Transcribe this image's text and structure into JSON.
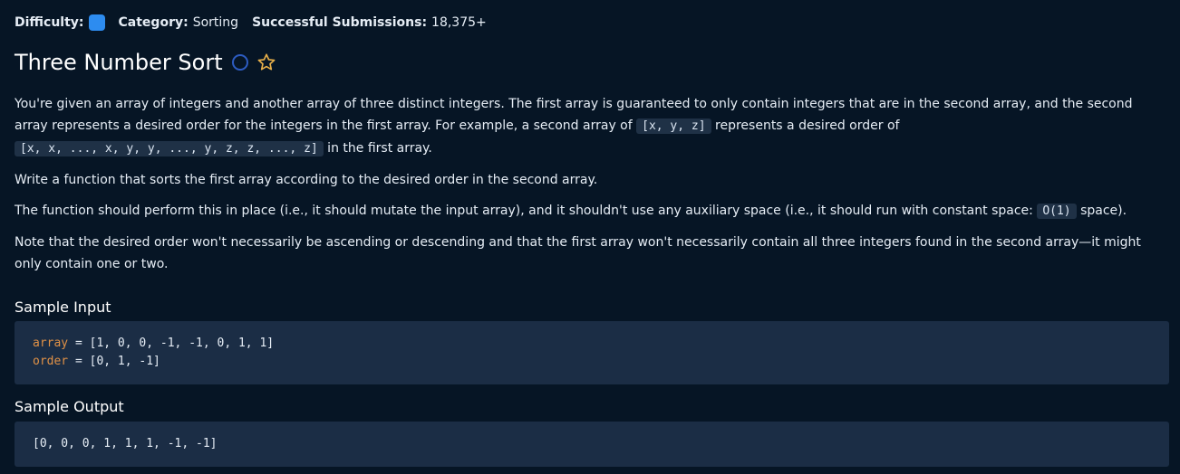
{
  "meta": {
    "difficulty_label": "Difficulty:",
    "category_label": "Category:",
    "category_value": "Sorting",
    "submissions_label": "Successful Submissions:",
    "submissions_value": "18,375+"
  },
  "colors": {
    "difficulty_chip": "#2d8cf0",
    "star": "#e8b04a",
    "background": "#061525",
    "code_background": "#1b2d45"
  },
  "icons": {
    "status": "circle-icon",
    "favorite": "star-icon"
  },
  "problem": {
    "title": "Three Number Sort",
    "p1_a": "You're given an array of integers and another array of three distinct integers. The first array is guaranteed to only contain integers that are in the second array, and the second array represents a desired order for the integers in the first array. For example, a second array of ",
    "p1_code1": "[x, y, z]",
    "p1_b": " represents a desired order of ",
    "p1_code2": "[x, x, ..., x, y, y, ..., y, z, z, ..., z]",
    "p1_c": " in the first array.",
    "p2": "Write a function that sorts the first array according to the desired order in the second array.",
    "p3_a": "The function should perform this in place (i.e., it should mutate the input array), and it shouldn't use any auxiliary space (i.e., it should run with constant space: ",
    "p3_code": "O(1)",
    "p3_b": " space).",
    "p4": "Note that the desired order won't necessarily be ascending or descending and that the first array won't necessarily contain all three integers found in the second array—it might only contain one or two."
  },
  "sample_input": {
    "label": "Sample Input",
    "line1_var": "array",
    "line1_rest": " = [1, 0, 0, -1, -1, 0, 1, 1]",
    "line2_var": "order",
    "line2_rest": " = [0, 1, -1]"
  },
  "sample_output": {
    "label": "Sample Output",
    "value": "[0, 0, 0, 1, 1, 1, -1, -1]"
  }
}
